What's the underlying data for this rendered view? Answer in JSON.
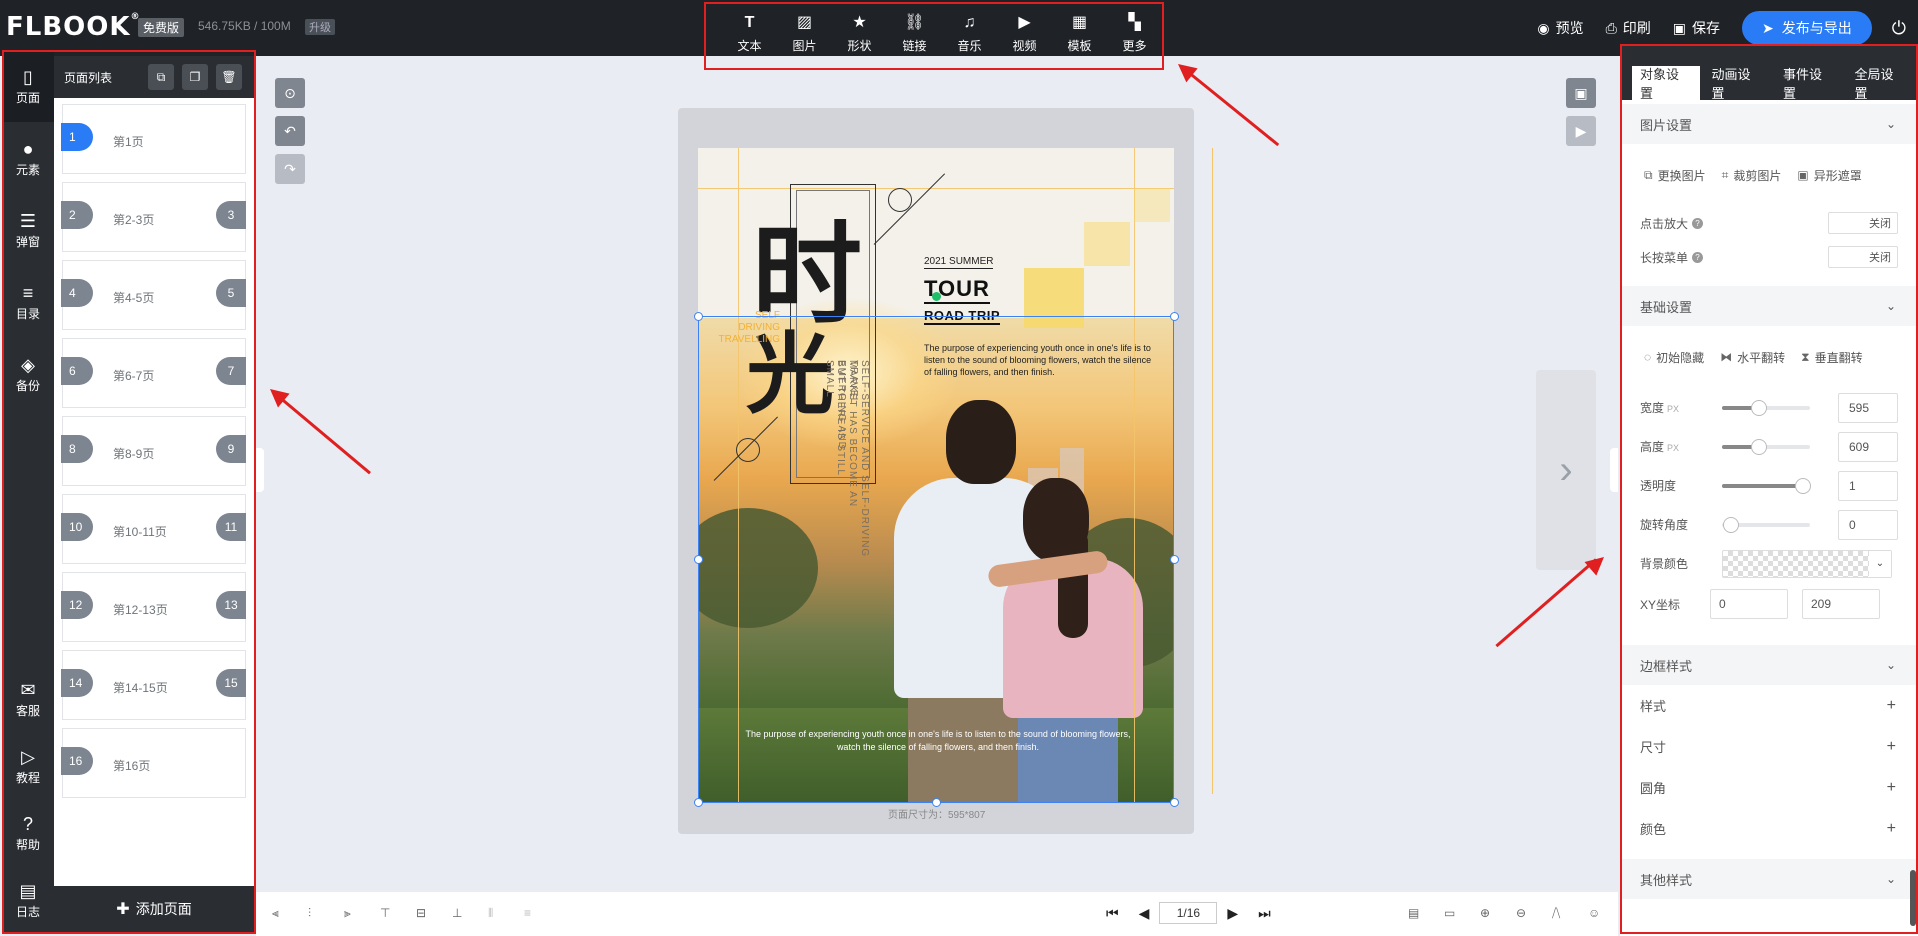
{
  "app": {
    "logo": "FLBOOK",
    "logo_mark": "®",
    "plan": "免费版",
    "storage": "546.75KB / 100M",
    "upgrade": "升级"
  },
  "toolbar": {
    "items": [
      {
        "label": "文本",
        "icon": "text-icon"
      },
      {
        "label": "图片",
        "icon": "image-icon"
      },
      {
        "label": "形状",
        "icon": "star-icon"
      },
      {
        "label": "链接",
        "icon": "link-icon"
      },
      {
        "label": "音乐",
        "icon": "music-icon"
      },
      {
        "label": "视频",
        "icon": "video-icon"
      },
      {
        "label": "模板",
        "icon": "template-icon"
      },
      {
        "label": "更多",
        "icon": "more-icon"
      }
    ]
  },
  "header_actions": {
    "preview": "预览",
    "print": "印刷",
    "save": "保存",
    "publish": "发布与导出"
  },
  "rail": {
    "items": [
      {
        "label": "页面",
        "icon": "page-icon"
      },
      {
        "label": "元素",
        "icon": "elements-icon"
      },
      {
        "label": "弹窗",
        "icon": "popup-icon"
      },
      {
        "label": "目录",
        "icon": "toc-icon"
      },
      {
        "label": "备份",
        "icon": "backup-icon"
      }
    ],
    "bottom": [
      {
        "label": "客服",
        "icon": "support-icon"
      },
      {
        "label": "教程",
        "icon": "tutorial-icon"
      },
      {
        "label": "帮助",
        "icon": "help-icon"
      },
      {
        "label": "日志",
        "icon": "log-icon"
      }
    ]
  },
  "pages_panel": {
    "title": "页面列表",
    "add_label": "添加页面",
    "pages": [
      {
        "left": "1",
        "right": "",
        "label": "第1页",
        "active": true
      },
      {
        "left": "2",
        "right": "3",
        "label": "第2-3页"
      },
      {
        "left": "4",
        "right": "5",
        "label": "第4-5页"
      },
      {
        "left": "6",
        "right": "7",
        "label": "第6-7页"
      },
      {
        "left": "8",
        "right": "9",
        "label": "第8-9页"
      },
      {
        "left": "10",
        "right": "11",
        "label": "第10-11页"
      },
      {
        "left": "12",
        "right": "13",
        "label": "第12-13页"
      },
      {
        "left": "14",
        "right": "15",
        "label": "第14-15页"
      },
      {
        "left": "16",
        "right": "",
        "label": "第16页"
      }
    ]
  },
  "poster": {
    "calligraphy_1": "时",
    "calligraphy_2": "光",
    "small_caption": "SELF\nDRIVING\nTRAVELLING",
    "vertical_text_1": "SELF-SERVICE AND SELF-DRIVING TRAVEL",
    "vertical_text_2": "MARKET HAS BECOME AN EMERGING AND",
    "vertical_text_3": "BUT THERE IS STILL SMALL",
    "summer": "2021 SUMMER",
    "tour": "TOUR",
    "road_trip": "ROAD TRIP",
    "paragraph": "The purpose of experiencing youth once in one's life is to listen to the sound of blooming flowers, watch the silence of falling flowers, and then finish.",
    "bottom_caption": "The purpose of experiencing youth once in one's life is to listen to the sound of blooming flowers, watch the silence of falling flowers, and then finish."
  },
  "canvas": {
    "page_size": "页面尺寸为：595*807"
  },
  "pager": {
    "current": "1/16"
  },
  "right_panel": {
    "tabs": [
      "对象设置",
      "动画设置",
      "事件设置",
      "全局设置"
    ],
    "image_settings": {
      "title": "图片设置",
      "replace": "更换图片",
      "crop": "裁剪图片",
      "mask": "异形遮罩",
      "click_zoom": "点击放大",
      "click_zoom_value": "关闭",
      "long_press": "长按菜单",
      "long_press_value": "关闭"
    },
    "basic_settings": {
      "title": "基础设置",
      "hide": "初始隐藏",
      "flip_h": "水平翻转",
      "flip_v": "垂直翻转",
      "width_label": "宽度",
      "width_unit": "PX",
      "width": "595",
      "width_level": 0.42,
      "height_label": "高度",
      "height_unit": "PX",
      "height": "609",
      "height_level": 0.42,
      "opacity_label": "透明度",
      "opacity": "1",
      "opacity_level": 0.92,
      "rotate_label": "旋转角度",
      "rotate": "0",
      "rotate_level": 0.0,
      "bg_label": "背景颜色",
      "xy_label": "XY坐标",
      "x": "0",
      "y": "209"
    },
    "border": {
      "title": "边框样式",
      "style": "样式",
      "size": "尺寸",
      "radius": "圆角",
      "color": "颜色"
    },
    "other": {
      "title": "其他样式"
    }
  },
  "colors": {
    "accent": "#2a7cf6",
    "dark": "#2a2e33",
    "annotation": "#e02020",
    "poster_yellow": "#f7d867"
  }
}
